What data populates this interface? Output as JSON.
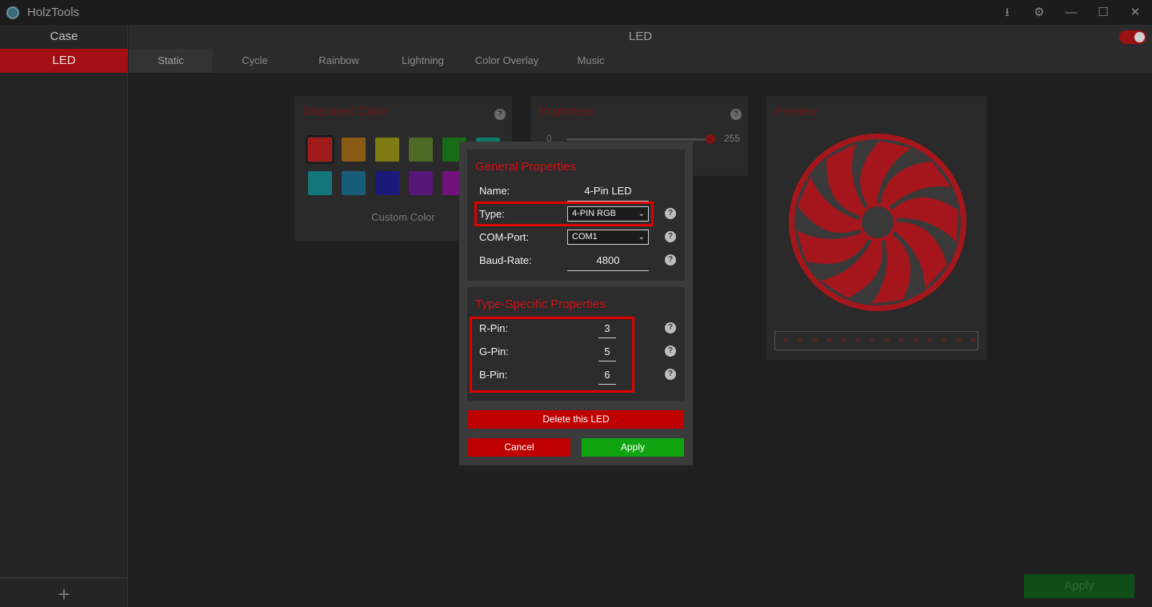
{
  "app": {
    "title": "HolzTools"
  },
  "window_controls": {
    "download": "⭳",
    "settings": "⚙",
    "minimize": "—",
    "maximize": "☐",
    "close": "✕"
  },
  "sidebar": {
    "items": [
      {
        "label": "Case"
      },
      {
        "label": "LED"
      }
    ],
    "add_label": "+"
  },
  "header": {
    "title": "LED"
  },
  "tabs": [
    {
      "label": "Static"
    },
    {
      "label": "Cycle"
    },
    {
      "label": "Rainbow"
    },
    {
      "label": "Lightning"
    },
    {
      "label": "Color Overlay"
    },
    {
      "label": "Music"
    }
  ],
  "displayed_color": {
    "title": "Displayed Color",
    "help": "?",
    "swatches": [
      "#a01c1c",
      "#8a5a14",
      "#7f7c14",
      "#4d6a25",
      "#176d17",
      "#0d7d6a",
      "#13767a",
      "#175d7a",
      "#1a1a7a",
      "#56167a",
      "#70127a"
    ],
    "custom_color_label": "Custom Color"
  },
  "brightness": {
    "title": "Brightness",
    "help": "?",
    "min_label": "0",
    "max_label": "255",
    "value": 255
  },
  "preview": {
    "title": "Preview",
    "fan_color": "#a4161b",
    "led_count": 14
  },
  "bottom": {
    "apply_label": "Apply"
  },
  "dialog": {
    "general": {
      "title": "General Properties",
      "name_label": "Name:",
      "name_value": "4-Pin LED",
      "type_label": "Type:",
      "type_value": "4-PIN RGB",
      "com_label": "COM-Port:",
      "com_value": "COM1",
      "baud_label": "Baud-Rate:",
      "baud_value": "4800",
      "help": "?"
    },
    "type_specific": {
      "title": "Type-Specific Properties",
      "pins": [
        {
          "label": "R-Pin:",
          "value": "3"
        },
        {
          "label": "G-Pin:",
          "value": "5"
        },
        {
          "label": "B-Pin:",
          "value": "6"
        }
      ],
      "help": "?"
    },
    "delete_label": "Delete this LED",
    "cancel_label": "Cancel",
    "apply_label": "Apply",
    "colors": {
      "delete": "#c00000",
      "cancel": "#c00000",
      "apply": "#10a510",
      "highlight": "#e00000"
    }
  }
}
